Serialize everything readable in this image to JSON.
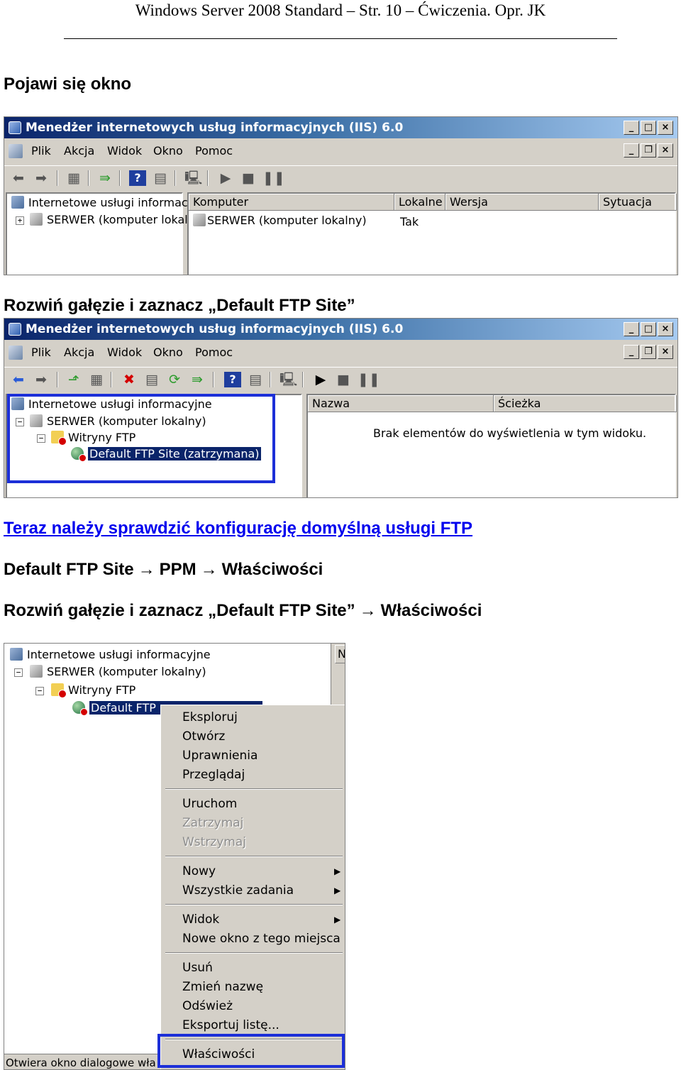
{
  "page": {
    "header": "Windows Server 2008 Standard – Str. 10 – Ćwiczenia. Opr. JK",
    "para1": "Pojawi się okno",
    "para2": "Rozwiń gałęzie i zaznacz „Default FTP Site”",
    "para3_link": "Teraz należy sprawdzić konfigurację domyślną usługi FTP",
    "para4": {
      "a": "Default FTP Site",
      "b": "PPM",
      "c": "Właściwości"
    },
    "para5": {
      "a": "Rozwiń gałęzie i zaznacz „Default FTP Site”",
      "b": "Właściwości"
    },
    "arrow": "→"
  },
  "window": {
    "title": "Menedżer internetowych usług informacyjnych (IIS) 6.0",
    "title_buttons": [
      "_",
      "□",
      "×"
    ],
    "mdi_buttons": [
      "_",
      "❐",
      "×"
    ],
    "menu": [
      "Plik",
      "Akcja",
      "Widok",
      "Okno",
      "Pomoc"
    ]
  },
  "screenshot1": {
    "tree": [
      "Internetowe usługi informacyjn",
      "SERWER (komputer lokalny"
    ],
    "columns": [
      "Komputer",
      "Lokalne",
      "Wersja",
      "Sytuacja"
    ],
    "row": {
      "computer": "SERWER (komputer lokalny)",
      "local": "Tak"
    }
  },
  "screenshot2": {
    "tree": [
      "Internetowe usługi informacyjne",
      "SERWER (komputer lokalny)",
      "Witryny FTP",
      "Default FTP Site (zatrzymana)"
    ],
    "columns": [
      "Nazwa",
      "Ścieżka"
    ],
    "empty_message": "Brak elementów do wyświetlenia w tym widoku."
  },
  "screenshot3": {
    "tree": [
      "Internetowe usługi informacyjne",
      "SERWER (komputer lokalny)",
      "Witryny FTP",
      "Default FTP"
    ],
    "column_stub": "N",
    "status": "Otwiera okno dialogowe wła",
    "menu_groups": [
      [
        {
          "label": "Eksploruj"
        },
        {
          "label": "Otwórz"
        },
        {
          "label": "Uprawnienia"
        },
        {
          "label": "Przeglądaj"
        }
      ],
      [
        {
          "label": "Uruchom"
        },
        {
          "label": "Zatrzymaj",
          "disabled": true
        },
        {
          "label": "Wstrzymaj",
          "disabled": true
        }
      ],
      [
        {
          "label": "Nowy",
          "submenu": true
        },
        {
          "label": "Wszystkie zadania",
          "submenu": true
        }
      ],
      [
        {
          "label": "Widok",
          "submenu": true
        },
        {
          "label": "Nowe okno z tego miejsca"
        }
      ],
      [
        {
          "label": "Usuń"
        },
        {
          "label": "Zmień nazwę"
        },
        {
          "label": "Odśwież"
        },
        {
          "label": "Eksportuj listę..."
        }
      ],
      [
        {
          "label": "Właściwości"
        }
      ]
    ]
  },
  "colors": {
    "highlight_frame": "#1c2fd8",
    "selection": "#0a246a",
    "link": "#0000ee"
  }
}
